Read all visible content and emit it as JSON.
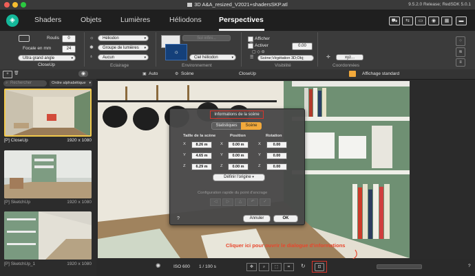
{
  "window": {
    "title": "3D A&A_resized_V2021+shadersSKP.atl",
    "version": "9.5.2.0 Release; RedSDK 5.0.1"
  },
  "app": {
    "logo": "diamond-logo-icon"
  },
  "tabs": [
    {
      "label": "Shaders"
    },
    {
      "label": "Objets"
    },
    {
      "label": "Lumières"
    },
    {
      "label": "Héliodons"
    },
    {
      "label": "Perspectives"
    }
  ],
  "active_tab": "Perspectives",
  "toolbar": {
    "roulis_label": "Roulis",
    "roulis_value": "0",
    "focale_label": "Focale en mm",
    "focale_value": "24",
    "lens_select": "Ultra grand angle",
    "camera_group": "CloseUp",
    "eclairage_heliodon": "Héliodon",
    "eclairage_groupe": "Groupe de lumières",
    "eclairage_aucun": "Aucun",
    "eclairage_label": "Eclairage",
    "env_button": "Sol infini...",
    "env_ciel": "Ciel héliodon",
    "env_label": "Environnement",
    "afficher_label": "Afficher",
    "activer_label": "Activer",
    "visibilite_value": "0.00",
    "visibilite_select": "Scène;Végétation 3D;Obj;",
    "visibilite_label": "Visibilité",
    "coords_button": "xyz...",
    "coords_label": "Coordonnées"
  },
  "subbar": {
    "auto": "Auto",
    "scene": "Scène",
    "camera": "CloseUp",
    "display": "Affichage standard"
  },
  "sidebar": {
    "search_placeholder": "Rechercher",
    "sort": "Ordre alphabétique",
    "items": [
      {
        "name": "[P] CloseUp",
        "res": "1920 x 1080"
      },
      {
        "name": "[P] SketchUp",
        "res": "1920 x 1080"
      },
      {
        "name": "[P] SketchUp_1",
        "res": "1920 x 1080"
      }
    ]
  },
  "dialog": {
    "title": "Informations de la scène",
    "tab_stats": "Statistiques",
    "tab_scene": "Scène",
    "col_size": "Taille de la scène",
    "col_position": "Position",
    "col_rotation": "Rotation",
    "axes": [
      "X",
      "Y",
      "Z"
    ],
    "size_values": [
      "8.26 m",
      "4.65 m",
      "6.29 m"
    ],
    "position_values": [
      "0.00 m",
      "0.00 m",
      "0.00 m"
    ],
    "rotation_values": [
      "0.00",
      "0.00",
      "0.00"
    ],
    "origin_button": "Définir l'origine",
    "anchor_label": "Configuration rapide du point d'ancrage",
    "help": "?",
    "cancel": "Annuler",
    "ok": "OK"
  },
  "annotation": {
    "text": "Cliquer ici pour ouvrir le dialogue d'informations",
    "color": "#e8462c"
  },
  "bottombar": {
    "iso": "ISO 600",
    "shutter": "1 / 100 s",
    "help": "?"
  },
  "colors": {
    "accent": "#f2a93b",
    "logo": "#14b89a",
    "highlight": "#d9352b"
  }
}
